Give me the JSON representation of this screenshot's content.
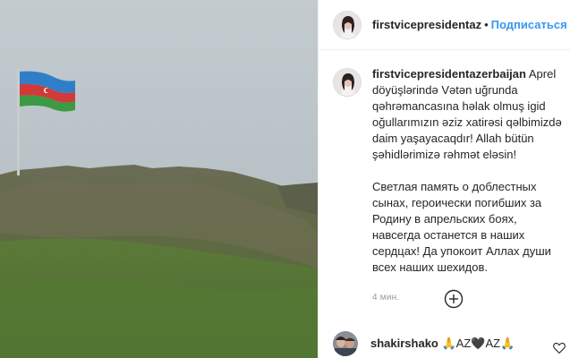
{
  "photo": {
    "description_icon": "flag-on-hill-photo"
  },
  "header": {
    "username": "firstvicepresidentaz",
    "separator": "•",
    "follow_label": "Подписаться",
    "avatar_icon": "profile-avatar-icon"
  },
  "caption": {
    "username": "firstvicepresidentazerbaijan",
    "text_az": "Aprel döyüşlərində Vətən uğrunda qəhrəmancasına həlak olmuş igid oğullarımızın əziz xatirəsi qəlbimizdə daim yaşayacaqdır! Allah bütün şəhidlərimizə rəhmət eləsin!",
    "text_ru": "Светлая память о доблестных сынах, героически погибших за Родину в апрельских боях, навсегда останется в наших сердцах! Да упокоит Аллах души всех наших шехидов.",
    "timestamp": "4 мин."
  },
  "load_more": {
    "icon": "plus-circle-icon"
  },
  "comment": {
    "username": "shakirshako",
    "text": "🙏AZ🖤AZ🙏",
    "like_icon": "heart-outline-icon"
  },
  "colors": {
    "link": "#3897f0",
    "text": "#262626",
    "muted": "#999999",
    "border": "#efefef"
  }
}
